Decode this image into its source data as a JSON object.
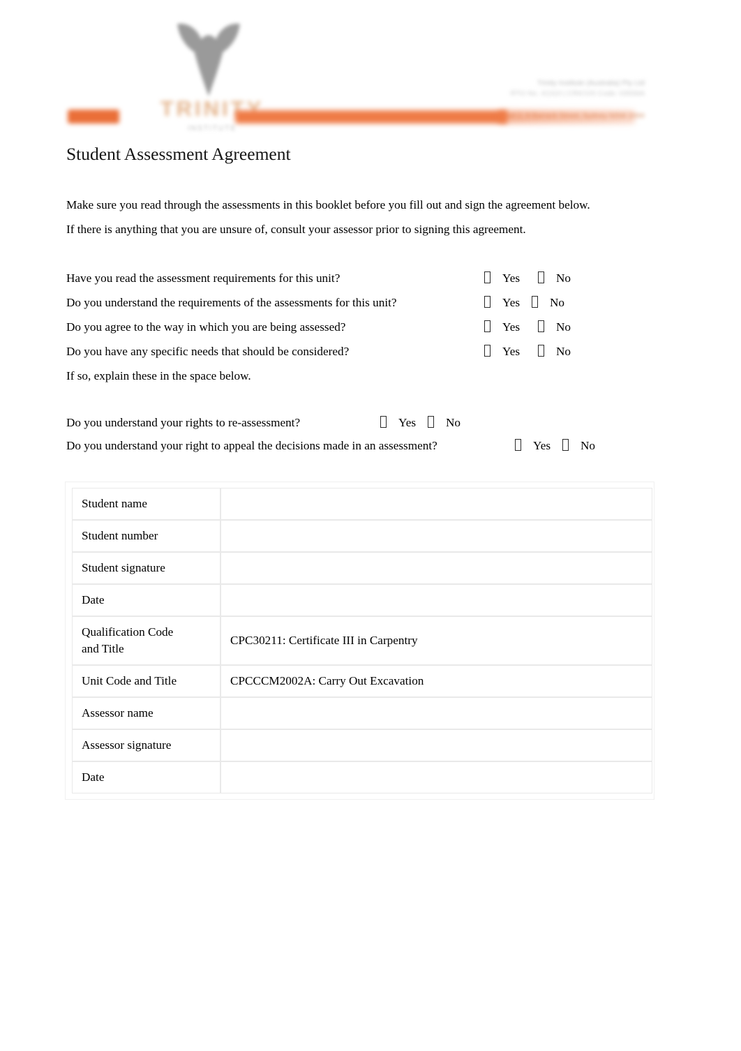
{
  "header": {
    "logo_mark": "bull-head-logo-icon",
    "logo_wordmark": "TRINITY",
    "logo_tagline": "INSTITUTE",
    "right_text_line1": "Trinity Institute (Australia) Pty Ltd",
    "right_text_line2": "RTO No. 41310 | CRICOS Code: 03556A",
    "right_text_line3": "Level 2, 9 Barrack Street, Sydney NSW 2000",
    "accent_color": "#ef7b46",
    "accent_color_dark": "#ea6f38"
  },
  "document": {
    "title": "Student Assessment Agreement",
    "intro": [
      "Make sure you read through the assessments in this booklet before you fill out and sign the agreement below.",
      "If there is anything that you are unsure of, consult your assessor prior to signing this agreement."
    ],
    "note": "If so, explain these in the space below."
  },
  "options": {
    "yes": "Yes",
    "no": "No",
    "checkbox_glyph": "empty-checkbox"
  },
  "questions_group_1": [
    {
      "text": "Have you read the assessment requirements for this unit?"
    },
    {
      "text": "Do you understand the requirements of the assessments for this unit?"
    },
    {
      "text": "Do you agree to the way in which you are being assessed?"
    },
    {
      "text": "Do you have any specific needs that should be considered?"
    }
  ],
  "questions_group_2": [
    {
      "text": "Do you understand your rights to re-assessment?"
    },
    {
      "text": "Do you understand your right to appeal the decisions made in an assessment?"
    }
  ],
  "table": {
    "rows": [
      {
        "label": "Student name",
        "value": ""
      },
      {
        "label": "Student number",
        "value": ""
      },
      {
        "label": "Student signature",
        "value": ""
      },
      {
        "label": "Date",
        "value": ""
      },
      {
        "label_line1": "Qualification Code",
        "label_line2": "and Title",
        "label": "Qualification Code and Title",
        "value": "CPC30211: Certificate III in Carpentry"
      },
      {
        "label": "Unit Code and Title",
        "value": "CPCCCM2002A: Carry Out Excavation"
      },
      {
        "label": "Assessor name",
        "value": ""
      },
      {
        "label": "Assessor signature",
        "value": ""
      },
      {
        "label": "Date",
        "value": ""
      }
    ]
  }
}
